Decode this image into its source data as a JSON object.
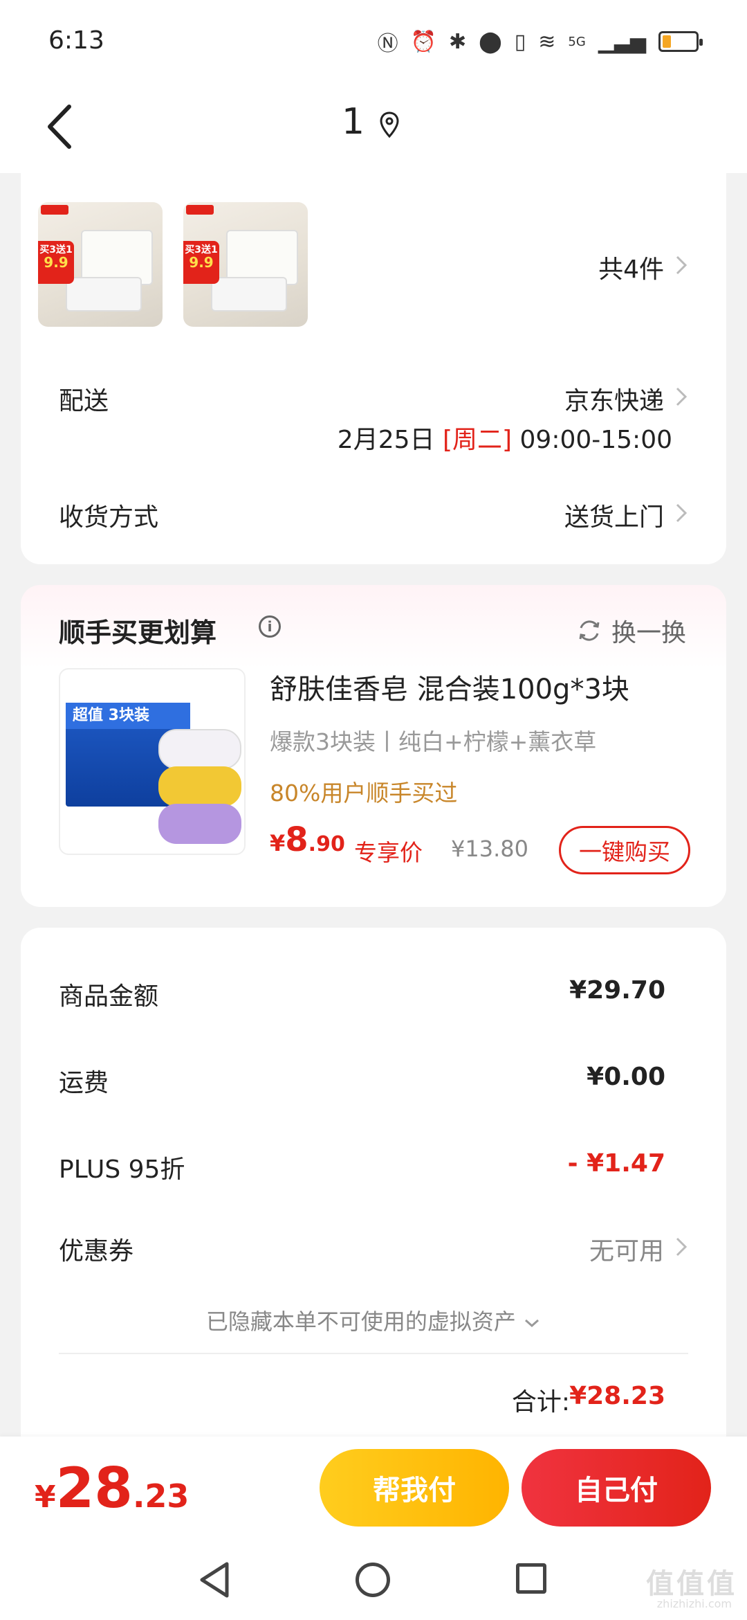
{
  "status": {
    "time": "6:13",
    "network": "5G"
  },
  "nav": {
    "title": "1"
  },
  "goods": {
    "count_label": "共4件",
    "thumb_tag_top": "买3送1",
    "thumb_tag_price": "9.9"
  },
  "delivery": {
    "label": "配送",
    "carrier": "京东快递",
    "date": "2月25日",
    "weekday": "[周二]",
    "time_window": "09:00-15:00"
  },
  "receive": {
    "label": "收货方式",
    "value": "送货上门"
  },
  "upsell": {
    "title": "顺手买更划算",
    "info_icon": "i",
    "refresh_label": "换一换",
    "product": {
      "box_label": "超值 3块装",
      "name": "舒肤佳香皂 混合装100g*3块",
      "spec": "爆款3块装丨纯白+柠檬+薰衣草",
      "hint": "80%用户顺手买过",
      "price_symbol": "¥",
      "price_int": "8",
      "price_dec": ".90",
      "exclusive_label": "专享价",
      "original_price": "¥13.80",
      "buy_label": "一键购买"
    }
  },
  "summary": {
    "goods_amount_label": "商品金额",
    "goods_amount": "¥29.70",
    "shipping_label": "运费",
    "shipping": "¥0.00",
    "plus_label": "PLUS 95折",
    "plus_discount": "- ¥1.47",
    "coupon_label": "优惠券",
    "coupon_value": "无可用",
    "hidden_note": "已隐藏本单不可使用的虚拟资产",
    "total_label": "合计:",
    "total": "¥28.23"
  },
  "bottom": {
    "price_symbol": "¥",
    "price_int": "28",
    "price_dec": ".23",
    "help_pay_label": "帮我付",
    "self_pay_label": "自己付"
  },
  "watermark": {
    "text": "值值值",
    "sub": "zhizhizhi.com"
  },
  "colors": {
    "accent_red": "#e2231a",
    "accent_yellow": "#ffc107",
    "hint_orange": "#c8862a"
  }
}
